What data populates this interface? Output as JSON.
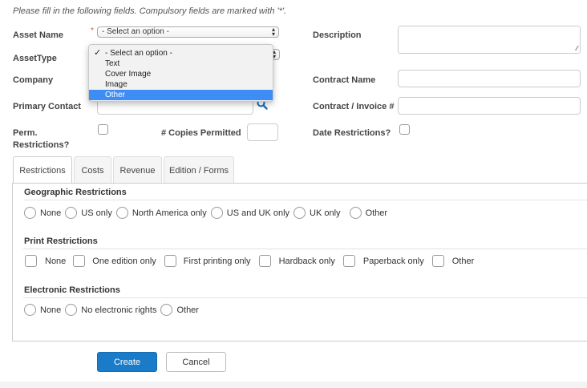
{
  "intro": "Please fill in the following fields. Compulsory fields are marked with '*'.",
  "fields": {
    "asset_name_label": "Asset Name",
    "required_marker": "*",
    "asset_name_value": "- Select an option -",
    "asset_type_label": "AssetType",
    "description_label": "Description",
    "company_label": "Company",
    "contract_name_label": "Contract Name",
    "primary_contact_label": "Primary Contact",
    "contract_invoice_label": "Contract / Invoice #",
    "perm_restrictions_label_1": "Perm.",
    "perm_restrictions_label_2": "Restrictions?",
    "copies_permitted_label": "# Copies Permitted",
    "date_restrictions_label": "Date Restrictions?"
  },
  "dropdown": {
    "options": [
      "- Select an option -",
      "Text",
      "Cover Image",
      "Image",
      "Other"
    ],
    "checked_index": 0,
    "highlighted_index": 4
  },
  "tabs": [
    "Restrictions",
    "Costs",
    "Revenue",
    "Edition / Forms"
  ],
  "active_tab": "Restrictions",
  "geographic": {
    "title": "Geographic Restrictions",
    "options": [
      "None",
      "US only",
      "North America only",
      "US and UK only",
      "UK only",
      "Other"
    ]
  },
  "print": {
    "title": "Print Restrictions",
    "options": [
      "None",
      "One edition only",
      "First printing only",
      "Hardback only",
      "Paperback only",
      "Other"
    ]
  },
  "electronic": {
    "title": "Electronic Restrictions",
    "options": [
      "None",
      "No electronic rights",
      "Other"
    ]
  },
  "buttons": {
    "create": "Create",
    "cancel": "Cancel"
  },
  "colors": {
    "primary": "#1a7bc9",
    "highlight": "#3d8df5",
    "required": "#d9534f"
  }
}
